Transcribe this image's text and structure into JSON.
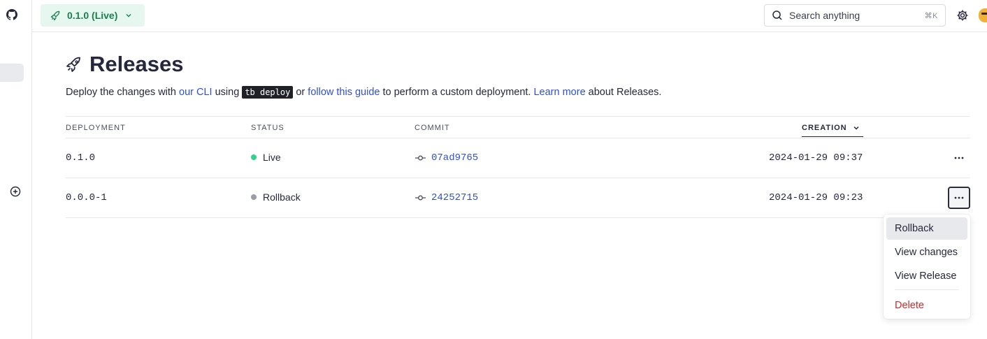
{
  "topbar": {
    "release_label": "0.1.0 (Live)",
    "search_placeholder": "Search anything",
    "search_shortcut": "⌘K"
  },
  "page": {
    "title": "Releases",
    "desc_prefix": "Deploy the changes with ",
    "desc_link_cli": "our CLI",
    "desc_using": " using ",
    "desc_code": "tb deploy",
    "desc_or": " or ",
    "desc_link_guide": "follow this guide",
    "desc_mid": " to perform a custom deployment. ",
    "desc_link_learn": "Learn more",
    "desc_suffix": " about Releases."
  },
  "table": {
    "headers": {
      "deployment": "DEPLOYMENT",
      "status": "STATUS",
      "commit": "COMMIT",
      "creation": "CREATION"
    },
    "rows": [
      {
        "deployment": "0.1.0",
        "status": "Live",
        "status_color": "#2fd38a",
        "commit": "07ad9765",
        "creation": "2024-01-29 09:37"
      },
      {
        "deployment": "0.0.0-1",
        "status": "Rollback",
        "status_color": "#9a9ca6",
        "commit": "24252715",
        "creation": "2024-01-29 09:23"
      }
    ]
  },
  "menu": {
    "rollback": "Rollback",
    "view_changes": "View changes",
    "view_release": "View Release",
    "delete": "Delete"
  },
  "colors": {
    "accent_link": "#2f4fd6",
    "live_green": "#1a7f4f",
    "danger": "#d12a2a"
  }
}
